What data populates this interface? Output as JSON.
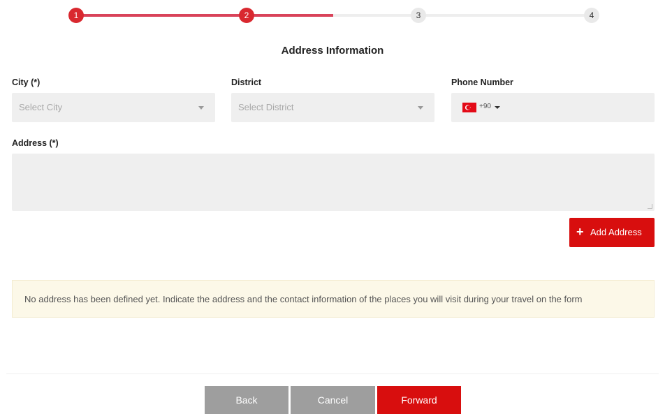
{
  "stepper": {
    "steps": [
      {
        "label": "1",
        "state": "completed"
      },
      {
        "label": "2",
        "state": "active"
      },
      {
        "label": "3",
        "state": "pending"
      },
      {
        "label": "4",
        "state": "pending"
      }
    ],
    "active_color": "#d9282f",
    "progress_color": "#d9435a"
  },
  "section_title": "Address Information",
  "form": {
    "city": {
      "label": "City (*)",
      "placeholder": "Select City"
    },
    "district": {
      "label": "District",
      "placeholder": "Select District"
    },
    "phone": {
      "label": "Phone Number",
      "country_code": "+90",
      "flag_icon": "turkey-flag-icon"
    },
    "address": {
      "label": "Address (*)",
      "value": ""
    }
  },
  "add_address_button": {
    "label": "Add Address",
    "icon": "plus-icon"
  },
  "notice": {
    "text": "No address has been defined yet. Indicate the address and the contact information of the places you will visit during your travel on the form"
  },
  "footer": {
    "back_label": "Back",
    "cancel_label": "Cancel",
    "forward_label": "Forward"
  },
  "colors": {
    "primary_red": "#d80e0e",
    "secondary_gray": "#9e9e9e",
    "notice_bg": "#fcf8e8",
    "input_bg": "#efefef"
  }
}
